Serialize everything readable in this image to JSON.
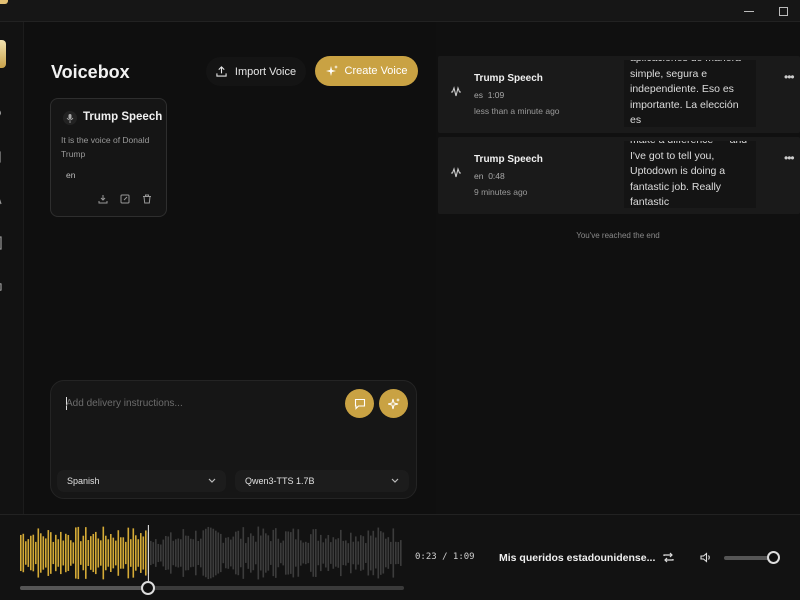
{
  "header": {
    "title": "Voicebox",
    "import_label": "Import Voice",
    "create_label": "Create Voice"
  },
  "voices": [
    {
      "name": "Trump Speech",
      "description": "It is the voice of Donald Trump",
      "language": "en"
    }
  ],
  "composer": {
    "placeholder": "Add delivery instructions...",
    "language": "Spanish",
    "model": "Qwen3-TTS 1.7B"
  },
  "generations": [
    {
      "name": "Trump Speech",
      "language": "es",
      "duration": "1:09",
      "time": "less than a minute ago",
      "text": "aplicaciones de manera simple, segura e independiente. Eso es importante. La elección es"
    },
    {
      "name": "Trump Speech",
      "language": "en",
      "duration": "0:48",
      "time": "9 minutes ago",
      "text": "make a difference — and I've got to tell you, Uptodown is doing a fantastic job. Really fantastic"
    }
  ],
  "end_text": "You've reached the end",
  "player": {
    "time": "0:23 / 1:09",
    "progress": 0.333,
    "title": "Mis queridos estadounidense...",
    "volume": 0.9
  },
  "colors": {
    "accent": "#c9a243",
    "waveform_played": "#d4aa36",
    "waveform_unplayed": "#3c3c3c"
  }
}
